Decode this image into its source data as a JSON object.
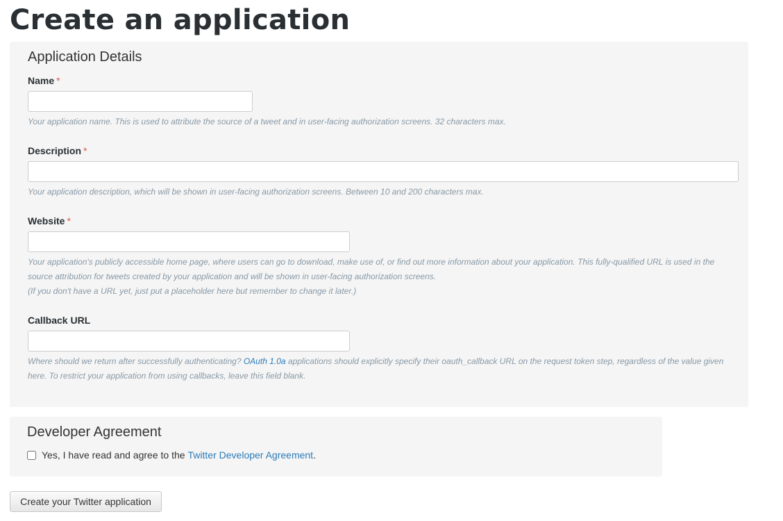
{
  "page": {
    "title": "Create an application"
  },
  "details": {
    "title": "Application Details",
    "required_marker": "*",
    "name": {
      "label": "Name",
      "value": "",
      "help": "Your application name. This is used to attribute the source of a tweet and in user-facing authorization screens. 32 characters max."
    },
    "description": {
      "label": "Description",
      "value": "",
      "help": "Your application description, which will be shown in user-facing authorization screens. Between 10 and 200 characters max."
    },
    "website": {
      "label": "Website",
      "value": "",
      "help": "Your application's publicly accessible home page, where users can go to download, make use of, or find out more information about your application. This fully-qualified URL is used in the source attribution for tweets created by your application and will be shown in user-facing authorization screens.",
      "help_note": "(If you don't have a URL yet, just put a placeholder here but remember to change it later.)"
    },
    "callback": {
      "label": "Callback URL",
      "value": "",
      "help_before": "Where should we return after successfully authenticating?",
      "help_link": "OAuth 1.0a",
      "help_after": "applications should explicitly specify their oauth_callback URL on the request token step, regardless of the value given here. To restrict your application from using callbacks, leave this field blank."
    }
  },
  "agreement": {
    "title": "Developer Agreement",
    "checkbox_text": "Yes, I have read and agree to the",
    "link_text": "Twitter Developer Agreement",
    "suffix": ".",
    "checked": false
  },
  "submit": {
    "label": "Create your Twitter application"
  },
  "colors": {
    "link": "#2b7bb9",
    "required": "#d9534f",
    "help_text": "#8899a6",
    "panel_bg": "#f5f5f5"
  }
}
